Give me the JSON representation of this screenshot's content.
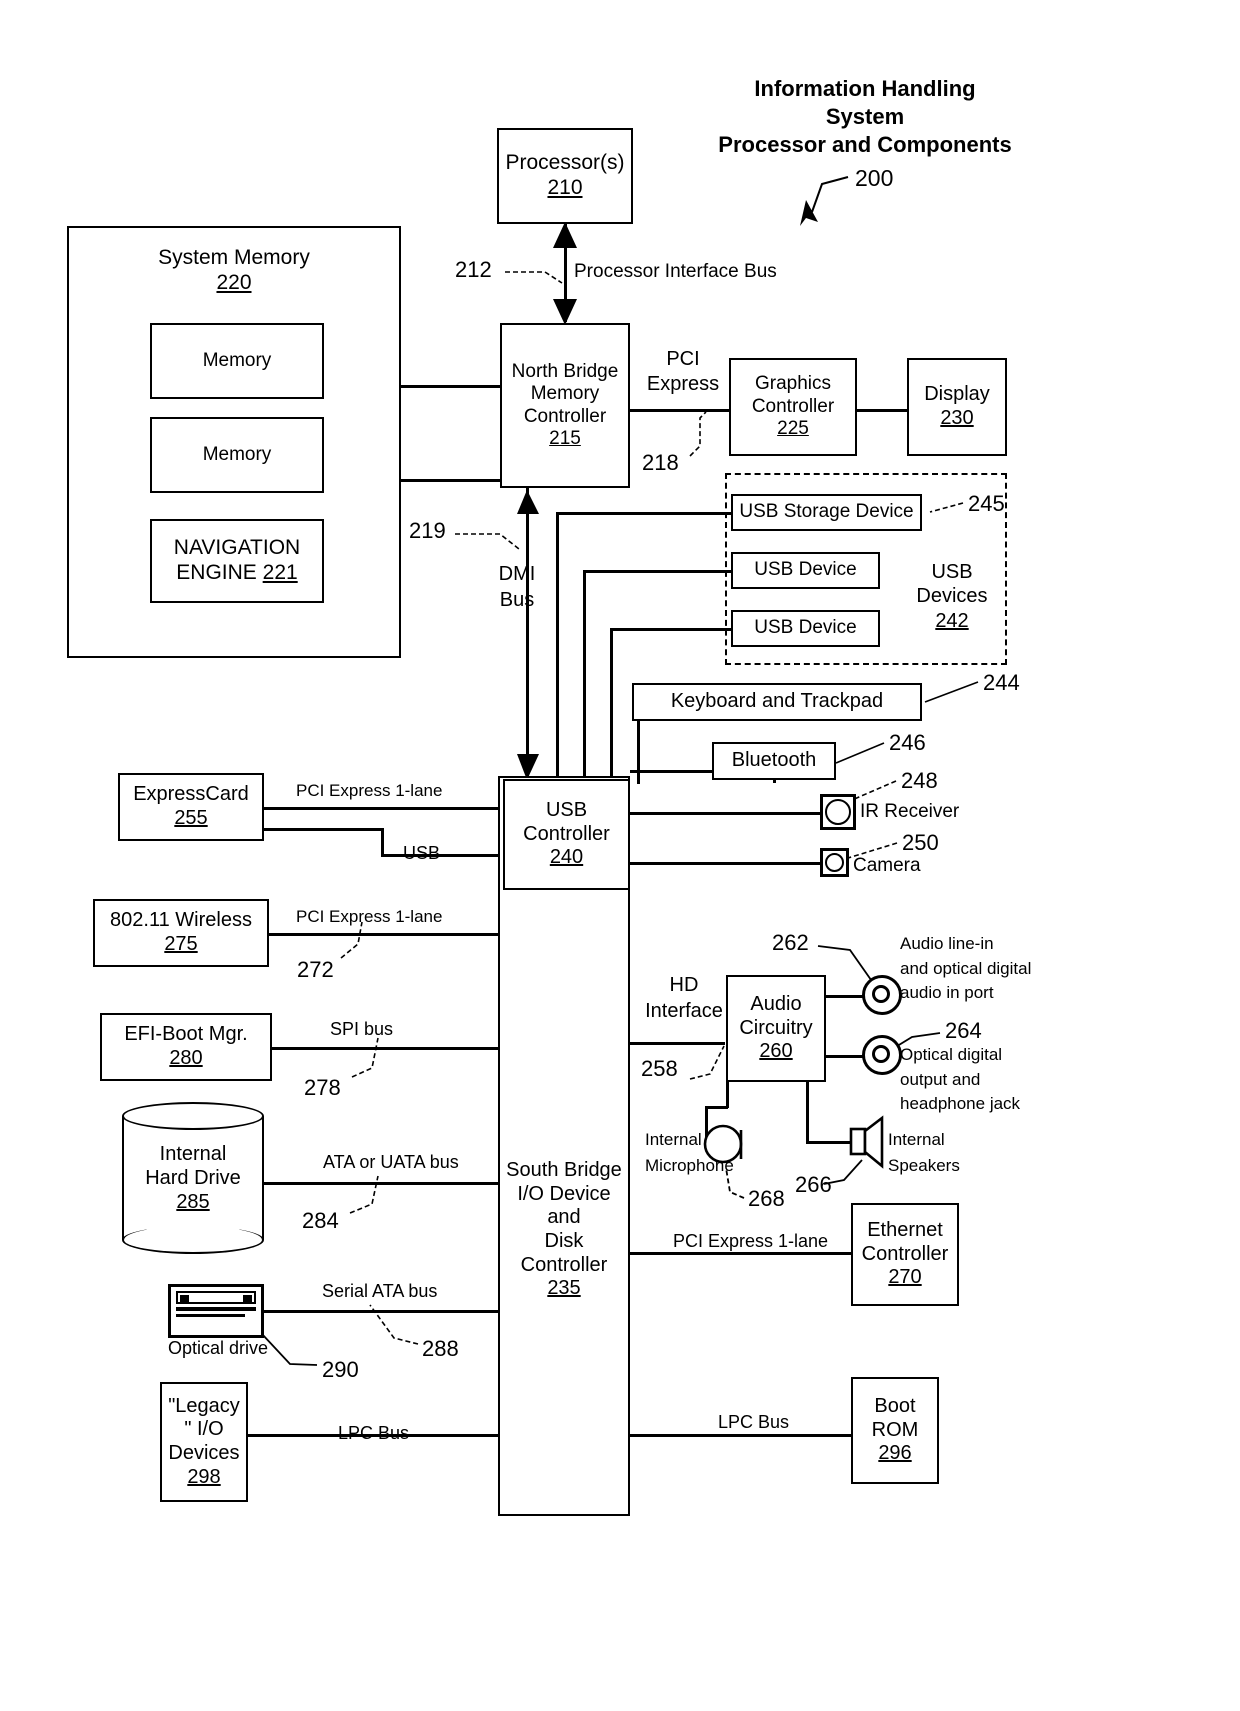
{
  "figure": {
    "title_lines": [
      "Information Handling",
      "System",
      "Processor and Components"
    ],
    "title_ref": "200"
  },
  "blocks": {
    "processor": {
      "label": "Processor(s)",
      "ref": "210"
    },
    "system_memory": {
      "label": "System Memory",
      "ref": "220"
    },
    "memory_1": {
      "label": "Memory"
    },
    "memory_2": {
      "label": "Memory"
    },
    "navigation_engine": {
      "label_1": "NAVIGATION",
      "label_2": "ENGINE",
      "ref": "221"
    },
    "north_bridge": {
      "label_1": "North Bridge",
      "label_2": "Memory",
      "label_3": "Controller",
      "ref": "215"
    },
    "graphics_controller": {
      "label_1": "Graphics",
      "label_2": "Controller",
      "ref": "225"
    },
    "display": {
      "label": "Display",
      "ref": "230"
    },
    "usb_storage_device": {
      "label": "USB Storage Device"
    },
    "usb_device_1": {
      "label": "USB Device"
    },
    "usb_device_2": {
      "label": "USB Device"
    },
    "usb_devices_group": {
      "label_1": "USB",
      "label_2": "Devices",
      "ref": "242"
    },
    "keyboard_trackpad": {
      "label": "Keyboard and Trackpad"
    },
    "bluetooth": {
      "label": "Bluetooth"
    },
    "ir_receiver": {
      "label": "IR Receiver"
    },
    "camera": {
      "label": "Camera"
    },
    "usb_controller": {
      "label_1": "USB",
      "label_2": "Controller",
      "ref": "240"
    },
    "expresscard": {
      "label": "ExpressCard",
      "ref": "255"
    },
    "wireless": {
      "label": "802.11 Wireless",
      "ref": "275"
    },
    "efi_boot_mgr": {
      "label": "EFI-Boot Mgr.",
      "ref": "280"
    },
    "internal_hard_drive": {
      "label_1": "Internal",
      "label_2": "Hard Drive",
      "ref": "285"
    },
    "optical_drive": {
      "label": "Optical drive"
    },
    "legacy_io_devices": {
      "label_1": "\"Legacy",
      "label_2": "\" I/O",
      "label_3": "Devices",
      "ref": "298"
    },
    "south_bridge": {
      "label_1": "South Bridge",
      "label_2": "I/O Device",
      "label_3": "and",
      "label_4": "Disk",
      "label_5": "Controller",
      "ref": "235"
    },
    "audio_circuitry": {
      "label_1": "Audio",
      "label_2": "Circuitry",
      "ref": "260"
    },
    "ethernet_controller": {
      "label_1": "Ethernet",
      "label_2": "Controller",
      "ref": "270"
    },
    "boot_rom": {
      "label_1": "Boot",
      "label_2": "ROM",
      "ref": "296"
    },
    "internal_microphone": {
      "label_1": "Internal",
      "label_2": "Microphone"
    },
    "internal_speakers": {
      "label_1": "Internal",
      "label_2": "Speakers"
    },
    "audio_line_in": {
      "line_1": "Audio line-in",
      "line_2": "and optical digital",
      "line_3": "audio in port"
    },
    "optical_digital_output": {
      "line_1": "Optical digital",
      "line_2": "output and",
      "line_3": "headphone jack"
    }
  },
  "bus_labels": {
    "processor_interface_bus": "Processor Interface Bus",
    "pci_express": {
      "line_1": "PCI",
      "line_2": "Express"
    },
    "dmi_bus": {
      "line_1": "DMI",
      "line_2": "Bus"
    },
    "pci_express_1_lane_expresscard": "PCI Express 1-lane",
    "usb": "USB",
    "pci_express_1_lane_wireless": "PCI Express 1-lane",
    "spi_bus": "SPI bus",
    "ata_or_uata_bus": "ATA or UATA bus",
    "serial_ata_bus": "Serial ATA bus",
    "lpc_bus_left": "LPC Bus",
    "lpc_bus_right": "LPC Bus",
    "hd_interface": {
      "line_1": "HD",
      "line_2": "Interface"
    },
    "pci_express_1_lane_ethernet": "PCI Express 1-lane"
  },
  "reference_numerals": {
    "n200": "200",
    "n212": "212",
    "n218": "218",
    "n219": "219",
    "n244": "244",
    "n245": "245",
    "n246": "246",
    "n248": "248",
    "n250": "250",
    "n258": "258",
    "n262": "262",
    "n264": "264",
    "n266": "266",
    "n268": "268",
    "n272": "272",
    "n278": "278",
    "n284": "284",
    "n288": "288",
    "n290": "290"
  }
}
